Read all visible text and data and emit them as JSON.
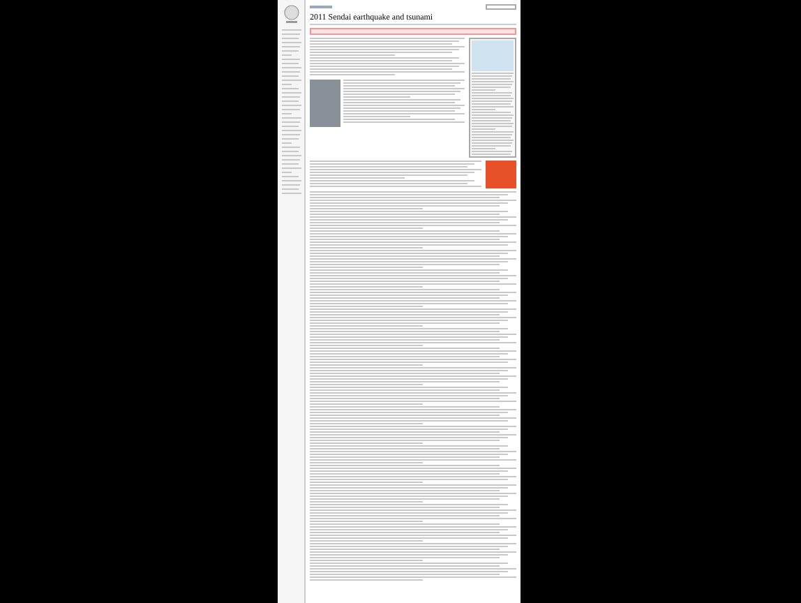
{
  "article": {
    "title": "2011 Sendai earthquake and tsunami"
  }
}
